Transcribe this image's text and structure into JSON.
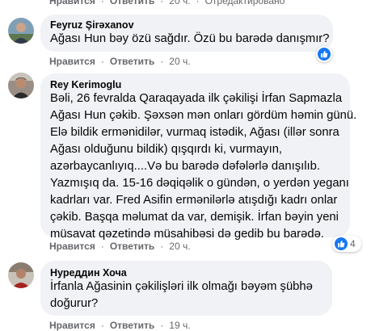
{
  "top_actions": {
    "like": "Нравится",
    "reply": "Ответить",
    "time": "20 ч.",
    "edited": "Отредактировано"
  },
  "comments": [
    {
      "author": "Feyruz Şirəxanov",
      "lines": [
        "Ağası Hun bəy özü sağdır. Özü bu barədə danışmır?"
      ],
      "actions": {
        "like": "Нравится",
        "reply": "Ответить",
        "time": "20 ч."
      }
    },
    {
      "author": "Rey Kerimoglu",
      "lines": [
        "Bəli, 26 fevralda Qaraqayada ilk çəkilişi İrfan Sapmazla",
        "Ağası Hun çəkib. Şəxsən mən onları gördüm həmin günü.",
        "Elə bildik erməni­dilər, vurmaq istədik, Ağası (illər sonra",
        "Ağası olduğunu bildik) qışqırdı ki, vurmayın,",
        "azərbaycanlıyıq....Və bu barədə dəfələrlə danışılıb.",
        "Yazmışıq da. 15-16 dəqiqəlik o gündən, o yerdən yeganı",
        "kadrları var. Fred Asifin ermənilərlə atışdığı kadrı onlar",
        "çəkib. Başqa məlumat da var, demişik. İrfan bəyin yeni",
        "müsavat qəzetində müsahibəsi də gedib bu barədə."
      ],
      "reaction_count": "4",
      "actions": {
        "like": "Нравится",
        "reply": "Ответить",
        "time": "20 ч."
      }
    },
    {
      "author": "Нуреддин Хоча",
      "lines": [
        "İrfanla Ağasinin çəkilişləri ilk olmağı bəyəm şübhə",
        "doğurur?"
      ],
      "actions": {
        "like": "Нравится",
        "reply": "Ответить",
        "time": "19 ч."
      }
    }
  ],
  "colors": {
    "bubble": "#f0f2f5",
    "meta": "#65676b",
    "like_blue": "#1877f2"
  },
  "icons": [
    "thumbs-up-icon"
  ]
}
